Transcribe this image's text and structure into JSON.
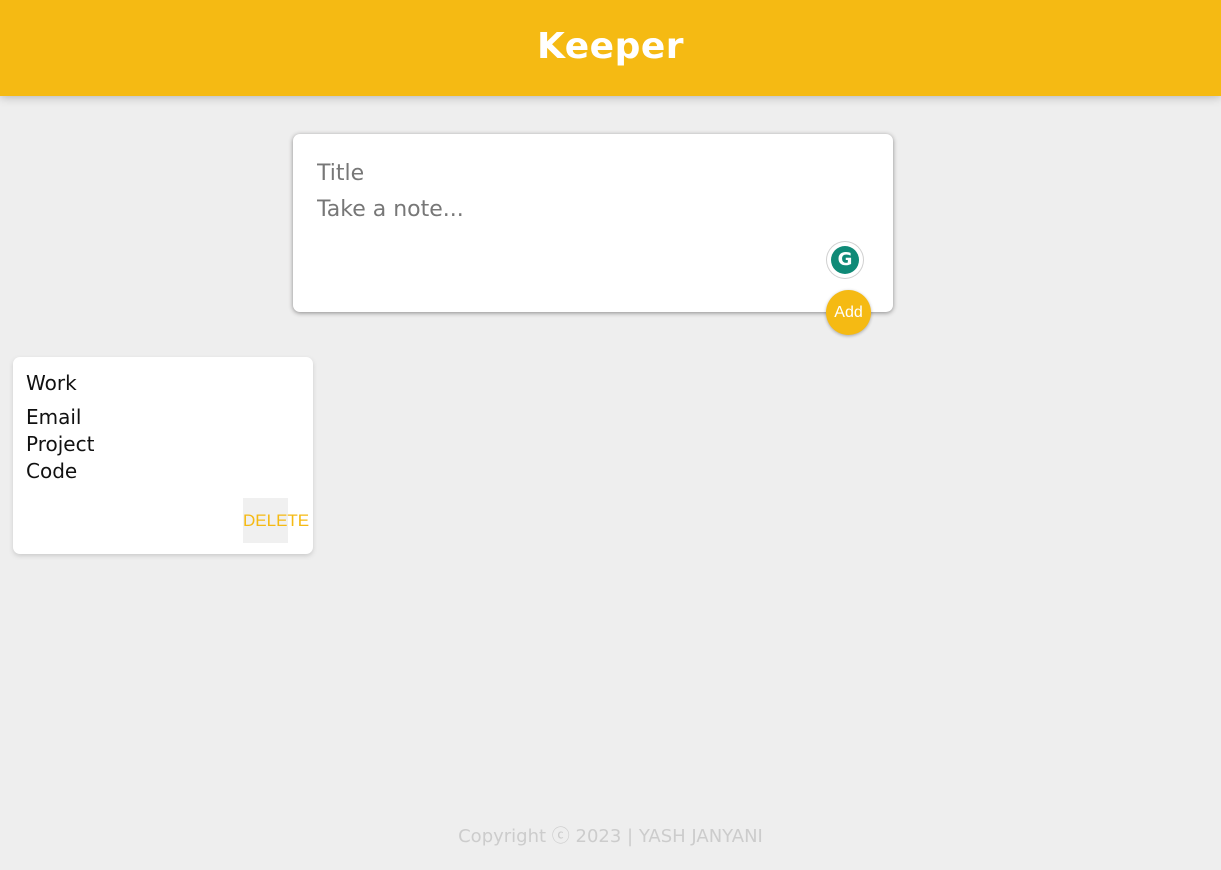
{
  "header": {
    "title": "Keeper"
  },
  "create_area": {
    "title_placeholder": "Title",
    "content_placeholder": "Take a note...",
    "add_label": "Add",
    "grammarly_letter": "G"
  },
  "notes": [
    {
      "title": "Work",
      "lines": [
        "Email",
        "Project",
        "Code"
      ],
      "delete_label": "DELETE"
    }
  ],
  "footer": {
    "text": "Copyright ⓒ 2023 | YASH JANYANI"
  },
  "colors": {
    "accent": "#f5ba13",
    "background": "#eeeeee",
    "grammarly": "#0f8a77"
  }
}
